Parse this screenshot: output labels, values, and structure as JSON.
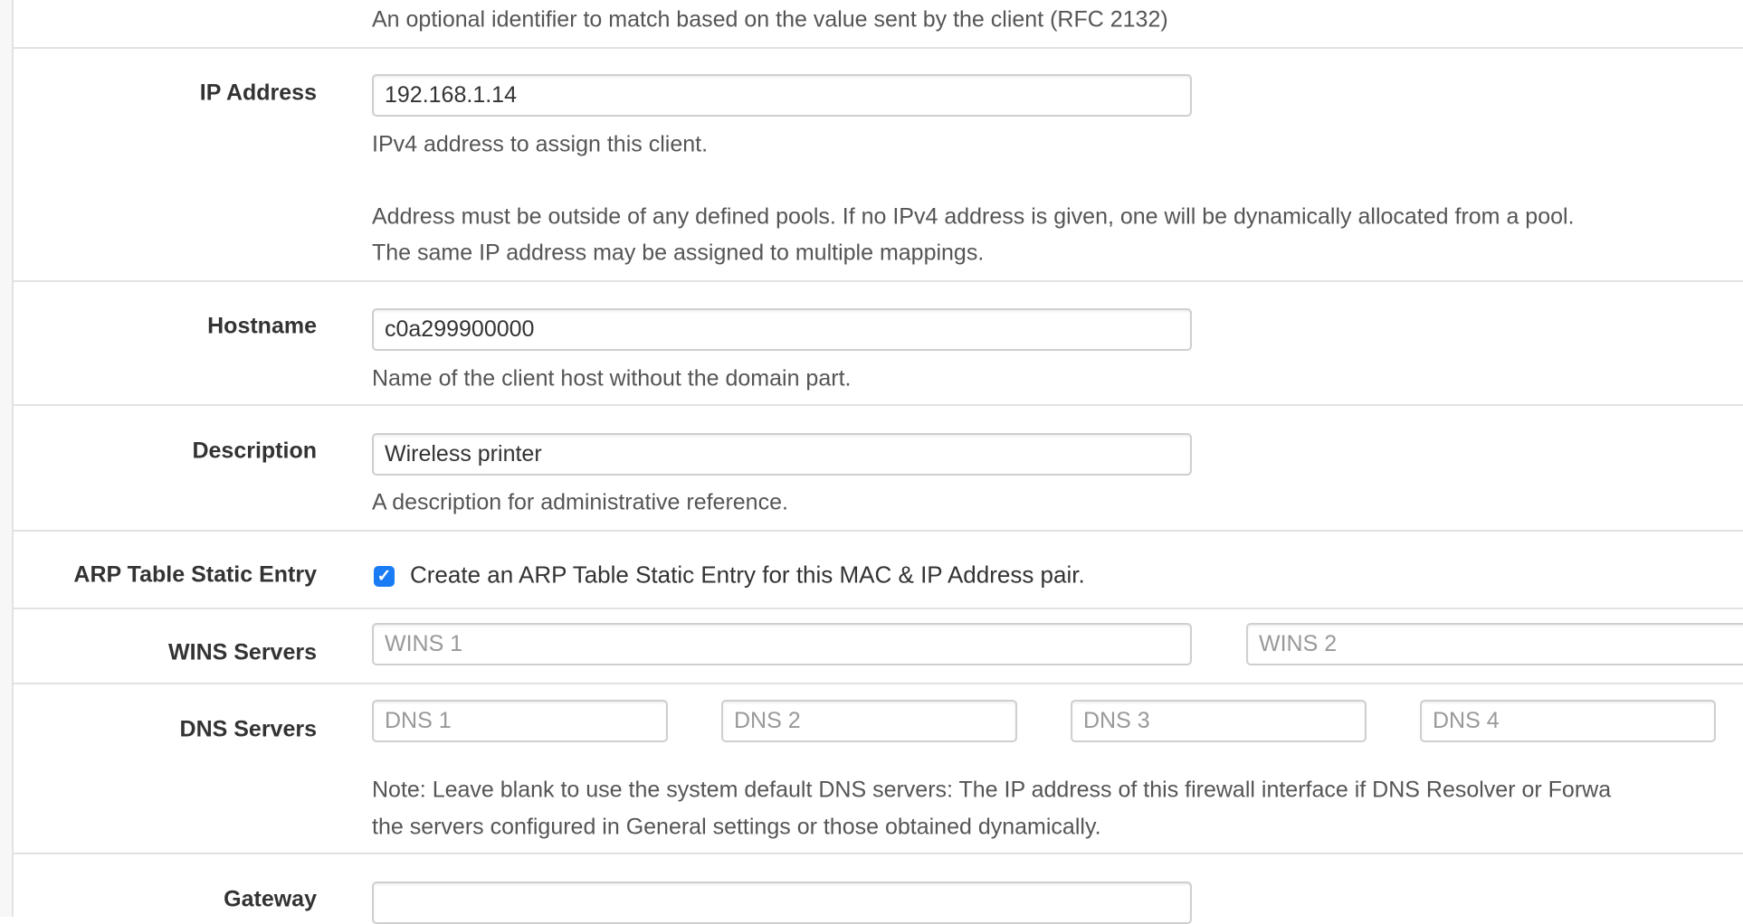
{
  "top_help": "An optional identifier to match based on the value sent by the client (RFC 2132)",
  "ip_address": {
    "label": "IP Address",
    "value": "192.168.1.14",
    "help1": "IPv4 address to assign this client.",
    "help2": "Address must be outside of any defined pools. If no IPv4 address is given, one will be dynamically allocated from a pool.",
    "help3": "The same IP address may be assigned to multiple mappings."
  },
  "hostname": {
    "label": "Hostname",
    "value": "c0a299900000",
    "help": "Name of the client host without the domain part."
  },
  "description": {
    "label": "Description",
    "value": "Wireless printer",
    "help": "A description for administrative reference."
  },
  "arp": {
    "label": "ARP Table Static Entry",
    "checked": true,
    "checkbox_label": "Create an ARP Table Static Entry for this MAC & IP Address pair.",
    "accent": "#1a7cf5"
  },
  "wins": {
    "label": "WINS Servers",
    "placeholders": [
      "WINS 1",
      "WINS 2"
    ]
  },
  "dns": {
    "label": "DNS Servers",
    "placeholders": [
      "DNS 1",
      "DNS 2",
      "DNS 3",
      "DNS 4"
    ],
    "note1": "Note: Leave blank to use the system default DNS servers: The IP address of this firewall interface if DNS Resolver or Forwa",
    "note2": "the servers configured in General settings or those obtained dynamically."
  },
  "gateway": {
    "label": "Gateway",
    "value": ""
  }
}
